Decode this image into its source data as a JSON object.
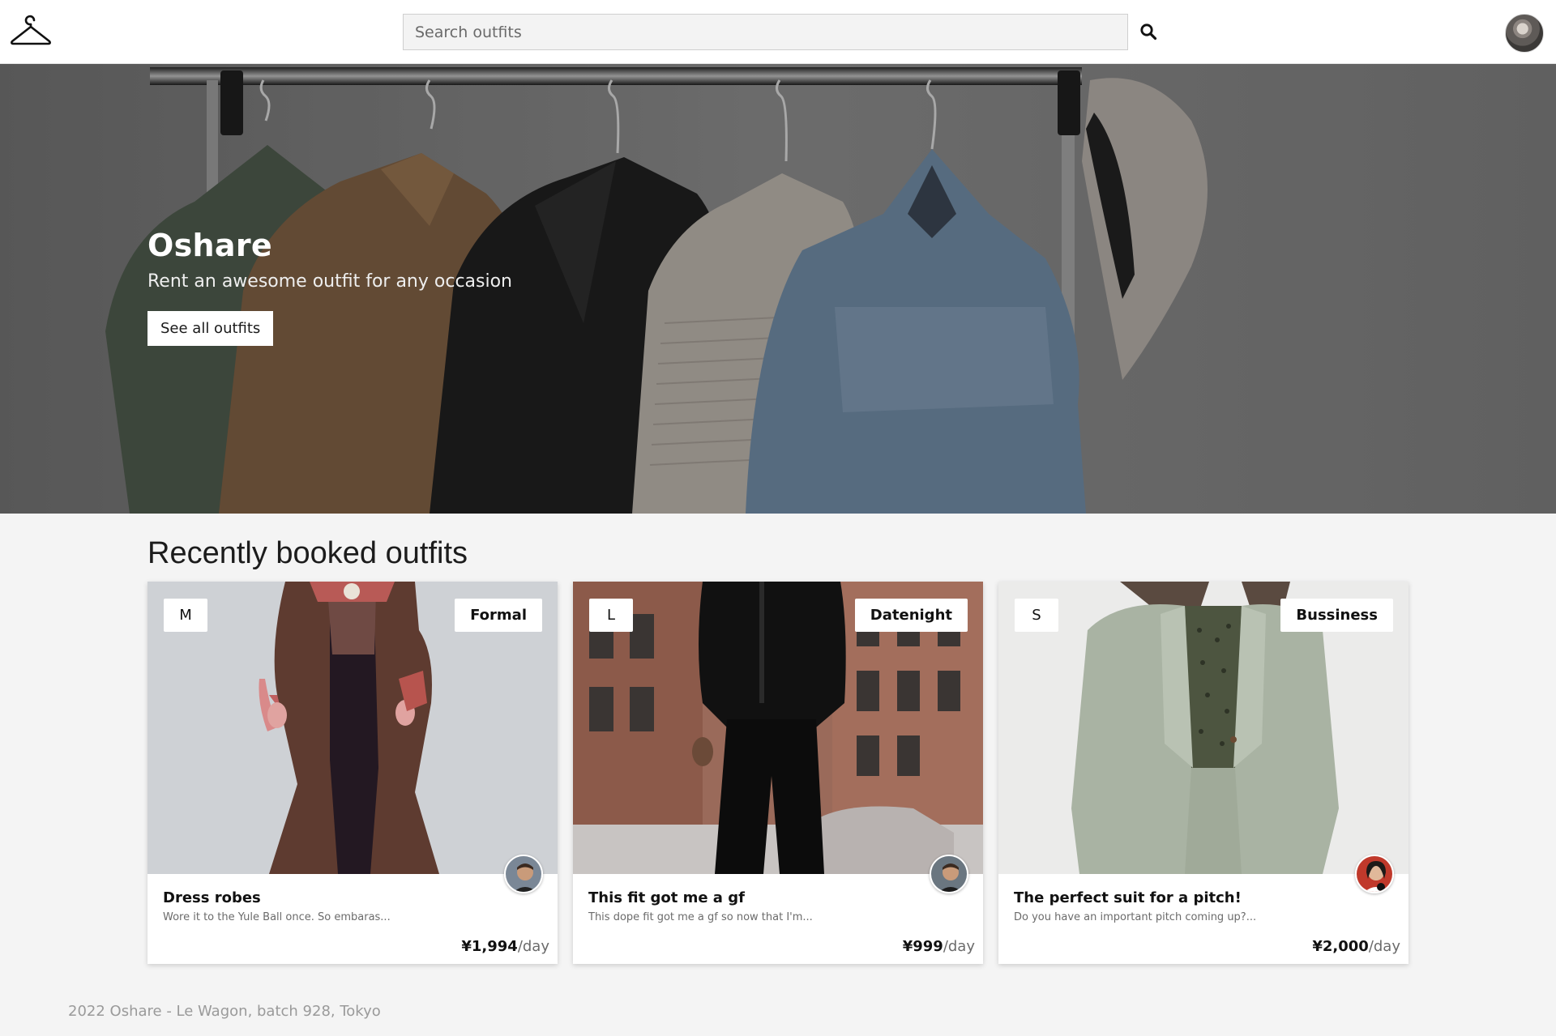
{
  "navbar": {
    "logo_icon": "hanger-icon",
    "search": {
      "placeholder": "Search outfits",
      "value": ""
    },
    "search_icon": "magnifier-icon",
    "avatar_icon": "user-avatar"
  },
  "hero": {
    "title": "Oshare",
    "subtitle": "Rent an awesome outfit for any occasion",
    "button_label": "See all outfits"
  },
  "section": {
    "title": "Recently booked outfits"
  },
  "cards": [
    {
      "size": "M",
      "category": "Formal",
      "title": "Dress robes",
      "description": "Wore it to the Yule Ball once. So embaras...",
      "price": "¥1,994",
      "per": "/day"
    },
    {
      "size": "L",
      "category": "Datenight",
      "title": "This fit got me a gf",
      "description": "This dope fit got me a gf so now that I'm...",
      "price": "¥999",
      "per": "/day"
    },
    {
      "size": "S",
      "category": "Bussiness",
      "title": "The perfect suit for a pitch!",
      "description": "Do you have an important pitch coming up?...",
      "price": "¥2,000",
      "per": "/day"
    }
  ],
  "footer": {
    "text": "2022 Oshare - Le Wagon, batch 928, Tokyo"
  },
  "colors": {
    "page_bg": "#f4f4f4",
    "navbar_bg": "#ffffff",
    "search_bg": "#f3f3f3",
    "hero_text": "#ffffff",
    "footer_text": "#9a9a9a"
  }
}
